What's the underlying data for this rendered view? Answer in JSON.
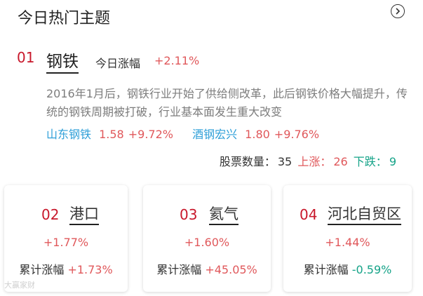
{
  "header": {
    "title": "今日热门主题",
    "more_icon": "chevron-right-circle-icon"
  },
  "hero": {
    "rank": "01",
    "name": "钢铁",
    "change_label": "今日涨幅",
    "change": "+2.11%",
    "description": "2016年1月后，钢铁行业开始了供给侧改革，此后钢铁价格大幅提升，传统的钢铁周期被打破，行业基本面发生重大改变",
    "stocks": [
      {
        "name": "山东钢铁",
        "price": "1.58",
        "change": "+9.72%"
      },
      {
        "name": "酒钢宏兴",
        "price": "1.80",
        "change": "+9.76%"
      }
    ],
    "summary": {
      "count_label": "股票数量：",
      "count": "35",
      "up_label": "上涨：",
      "up": "26",
      "down_label": "下跌：",
      "down": "9"
    }
  },
  "cards": [
    {
      "rank": "02",
      "name": "港口",
      "change": "+1.77%",
      "total_label": "累计涨幅",
      "total": "+1.73%"
    },
    {
      "rank": "03",
      "name": "氦气",
      "change": "+1.60%",
      "total_label": "累计涨幅",
      "total": "+45.05%"
    },
    {
      "rank": "04",
      "name": "河北自贸区",
      "change": "+1.44%",
      "total_label": "累计涨幅",
      "total": "-0.59%"
    }
  ],
  "colors": {
    "rank": "#c8182b",
    "up": "#e0585b",
    "down": "#15a388",
    "stock": "#2e9fd8"
  },
  "watermark": "大赢家财"
}
